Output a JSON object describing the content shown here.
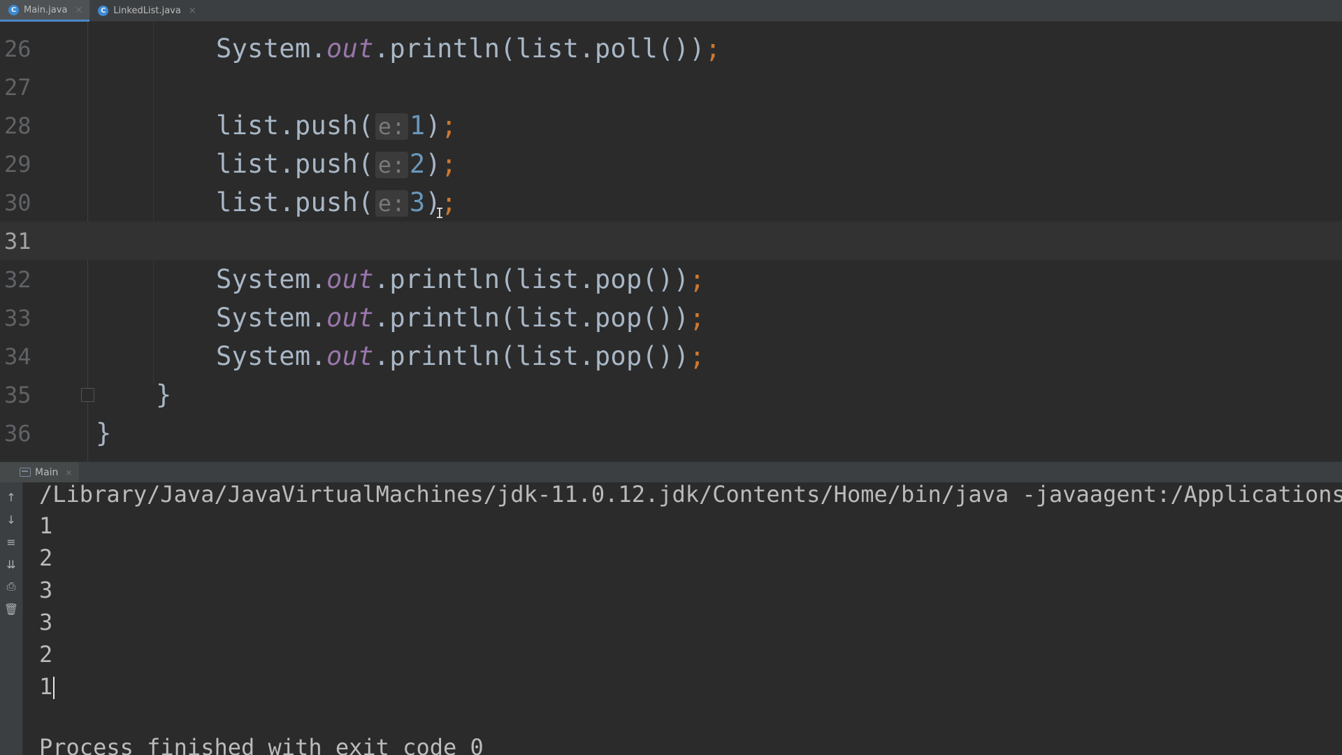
{
  "tabs": [
    {
      "label": "Main.java",
      "icon": "java-class-icon",
      "active": true
    },
    {
      "label": "LinkedList.java",
      "icon": "java-class-icon",
      "active": false
    }
  ],
  "editor": {
    "lines": [
      {
        "number": "26",
        "text": "System.out.println(list.poll());"
      },
      {
        "number": "27",
        "text": ""
      },
      {
        "number": "28",
        "text": "list.push(e: 1);"
      },
      {
        "number": "29",
        "text": "list.push(e: 2);"
      },
      {
        "number": "30",
        "text": "list.push(e: 3);"
      },
      {
        "number": "31",
        "text": ""
      },
      {
        "number": "32",
        "text": "System.out.println(list.pop());"
      },
      {
        "number": "33",
        "text": "System.out.println(list.pop());"
      },
      {
        "number": "34",
        "text": "System.out.println(list.pop());"
      },
      {
        "number": "35",
        "text": "}"
      },
      {
        "number": "36",
        "text": "}"
      }
    ],
    "current_line": "31",
    "hint_label": "e:",
    "push_values": [
      "1",
      "2",
      "3"
    ]
  },
  "run_panel": {
    "tab_label": "Main",
    "command": "/Library/Java/JavaVirtualMachines/jdk-11.0.12.jdk/Contents/Home/bin/java -javaagent:/Applications/Intelli",
    "output": [
      "1",
      "2",
      "3",
      "3",
      "2",
      "1"
    ],
    "exit_message": "Process finished with exit code 0"
  },
  "colors": {
    "background": "#2b2b2b",
    "keyword_field": "#9876aa",
    "punctuation": "#cc7832",
    "number": "#6897bb",
    "text": "#a9b7c6"
  }
}
